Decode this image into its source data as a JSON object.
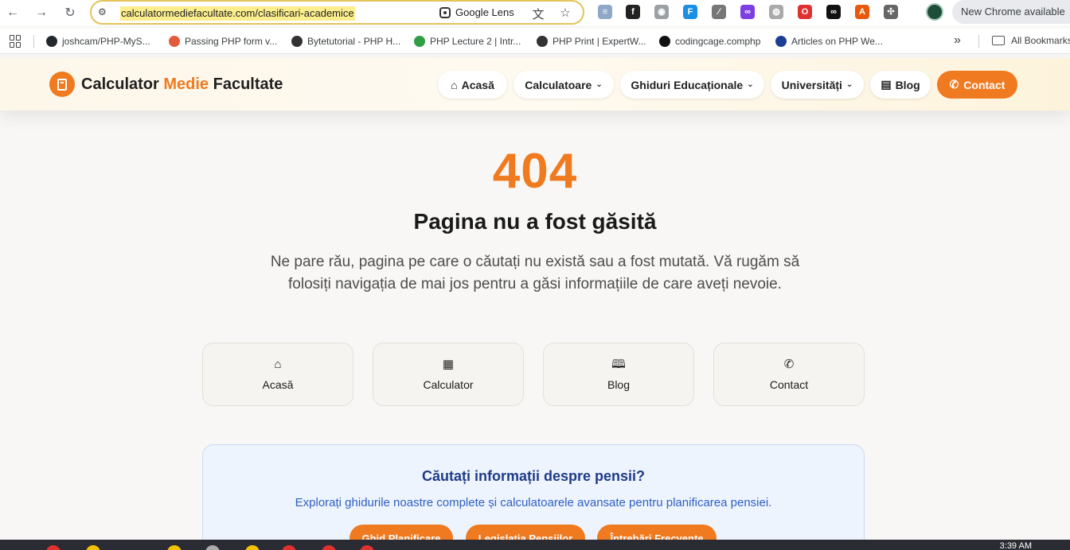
{
  "browser": {
    "url": "calculatormediefacultate.com/clasificari-academice",
    "lens_label": "Google Lens",
    "update_label": "New Chrome available",
    "bookmarks": [
      {
        "label": "joshcam/PHP-MyS...",
        "color": "#24292e"
      },
      {
        "label": "Passing PHP form v...",
        "color": "#e25b3b"
      },
      {
        "label": "Bytetutorial - PHP H...",
        "color": "#333333"
      },
      {
        "label": "PHP Lecture 2 | Intr...",
        "color": "#2f9e44"
      },
      {
        "label": "PHP Print | ExpertW...",
        "color": "#333333"
      },
      {
        "label": "codingcage.comphp",
        "color": "#111111"
      },
      {
        "label": "Articles on PHP We...",
        "color": "#1c3f94"
      }
    ],
    "all_bookmarks_label": "All Bookmarks"
  },
  "site": {
    "logo_part1": "Calculator",
    "logo_part2": "Medie",
    "logo_part3": "Facultate",
    "nav": {
      "home": "Acasă",
      "calculators": "Calculatoare",
      "guides": "Ghiduri Educaționale",
      "universities": "Universități",
      "blog": "Blog",
      "contact": "Contact"
    },
    "accent_color": "#f07a1f"
  },
  "error": {
    "code": "404",
    "title": "Pagina nu a fost găsită",
    "description": "Ne pare rău, pagina pe care o căutați nu există sau a fost mutată. Vă rugăm să folosiți navigația de mai jos pentru a găsi informațiile de care aveți nevoie."
  },
  "quick_links": [
    {
      "label": "Acasă",
      "icon": "home-icon"
    },
    {
      "label": "Calculator",
      "icon": "calculator-icon"
    },
    {
      "label": "Blog",
      "icon": "book-icon"
    },
    {
      "label": "Contact",
      "icon": "phone-icon"
    }
  ],
  "pension": {
    "title": "Căutați informații despre pensii?",
    "description": "Explorați ghidurile noastre complete și calculatoarele avansate pentru planificarea pensiei.",
    "buttons": [
      "Ghid Planificare",
      "Legislația Pensiilor",
      "Întrebări Frecvente"
    ]
  },
  "taskbar": {
    "time": "3:39 AM"
  }
}
